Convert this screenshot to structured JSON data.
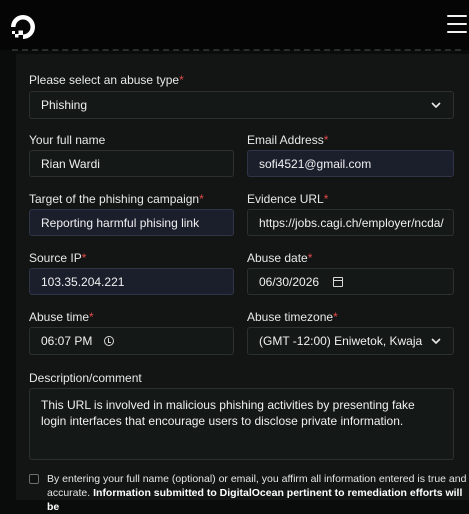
{
  "form": {
    "abuse_type": {
      "label": "Please select an abuse type",
      "value": "Phishing"
    },
    "full_name": {
      "label": "Your full name",
      "value": "Rian Wardi"
    },
    "email": {
      "label": "Email Address",
      "value": "sofi4521@gmail.com"
    },
    "target": {
      "label": "Target of the phishing campaign",
      "value": "Reporting harmful phising link"
    },
    "evidence_url": {
      "label": "Evidence URL",
      "value": "https://jobs.cagi.ch/employer/ncda/"
    },
    "source_ip": {
      "label": "Source IP",
      "value": "103.35.204.221"
    },
    "abuse_date": {
      "label": "Abuse date",
      "value": "06/30/2026"
    },
    "abuse_time": {
      "label": "Abuse time",
      "value": "06:07 PM"
    },
    "timezone": {
      "label": "Abuse timezone",
      "value": "(GMT -12:00) Eniwetok, Kwaja"
    },
    "description": {
      "label": "Description/comment",
      "value": "This URL is involved in malicious phishing activities by presenting fake login interfaces that encourage users to disclose private information."
    },
    "required_mark": "*"
  },
  "consent": {
    "text": "By entering your full name (optional) or email, you affirm all information entered is true and accurate. ",
    "bold": "Information submitted to DigitalOcean pertinent to remediation efforts will be"
  },
  "icons": {
    "logo": "digitalocean-logo",
    "menu": "hamburger-menu-icon",
    "chevron": "chevron-down-icon",
    "calendar": "calendar-icon",
    "clock": "clock-icon"
  },
  "colors": {
    "background": "#0a0c0b",
    "card": "#121514",
    "field_bg": "#1b1f2c",
    "required": "#e24a4a"
  }
}
